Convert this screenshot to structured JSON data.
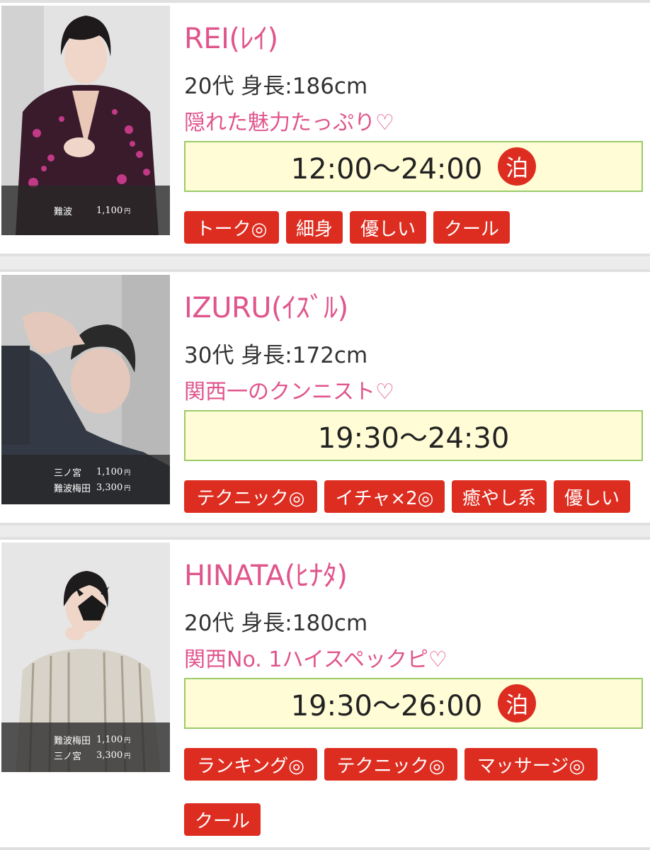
{
  "hosts": [
    {
      "name": "REI(ﾚｲ)",
      "meta": "20代 身長:186cm",
      "catch": "隠れた魅力たっぷり♡",
      "hours": "12:00〜24:00",
      "stay": "泊",
      "stores": [
        {
          "name": "難波",
          "price": "1,100",
          "unit": "円"
        }
      ],
      "tags": [
        "トーク◎",
        "細身",
        "優しい",
        "クール"
      ]
    },
    {
      "name": "IZURU(ｲｽﾞﾙ)",
      "meta": "30代 身長:172cm",
      "catch": "関西一のクンニスト♡",
      "hours": "19:30〜24:30",
      "stay": null,
      "stores": [
        {
          "name": "三ノ宮",
          "price": "1,100",
          "unit": "円"
        },
        {
          "name": "難波梅田",
          "price": "3,300",
          "unit": "円"
        }
      ],
      "tags": [
        "テクニック◎",
        "イチャ×2◎",
        "癒やし系",
        "優しい"
      ]
    },
    {
      "name": "HINATA(ﾋﾅﾀ)",
      "meta": "20代 身長:180cm",
      "catch": "関西No. 1ハイスペックピ♡",
      "hours": "19:30〜26:00",
      "stay": "泊",
      "stores": [
        {
          "name": "難波梅田",
          "price": "1,100",
          "unit": "円"
        },
        {
          "name": "三ノ宮",
          "price": "3,300",
          "unit": "円"
        }
      ],
      "tags": [
        "ランキング◎",
        "テクニック◎",
        "マッサージ◎",
        "クール"
      ]
    }
  ],
  "colors": {
    "accent_pink": "#e0558c",
    "tag_red": "#dd2d20",
    "hours_bg": "#fffcd6",
    "hours_border": "#9acb6a"
  }
}
